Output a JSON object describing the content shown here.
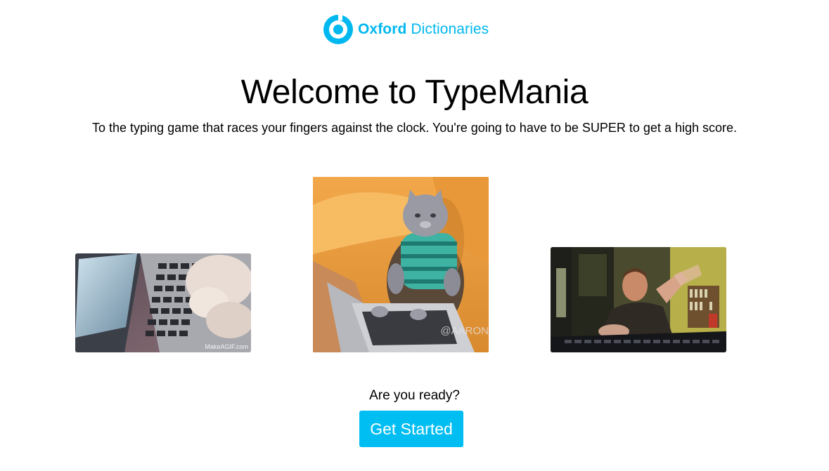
{
  "brand": {
    "name_bold": "Oxford",
    "name_light": "Dictionaries",
    "color": "#00b8f0",
    "logo_icon": "oxford-dictionaries-logo-icon"
  },
  "hero": {
    "title": "Welcome to TypeMania",
    "subtitle": "To the typing game that races your fingers against the clock. You're going to have to be SUPER to get a high score."
  },
  "gallery": [
    {
      "name": "typing-hands-gif",
      "watermark": "MakeAGIF.com"
    },
    {
      "name": "typing-cat-gif",
      "watermark": "@AARON"
    },
    {
      "name": "frantic-typing-man-gif",
      "watermark": ""
    }
  ],
  "cta": {
    "prompt": "Are you ready?",
    "button_label": "Get Started",
    "color": "#00bdf2"
  }
}
